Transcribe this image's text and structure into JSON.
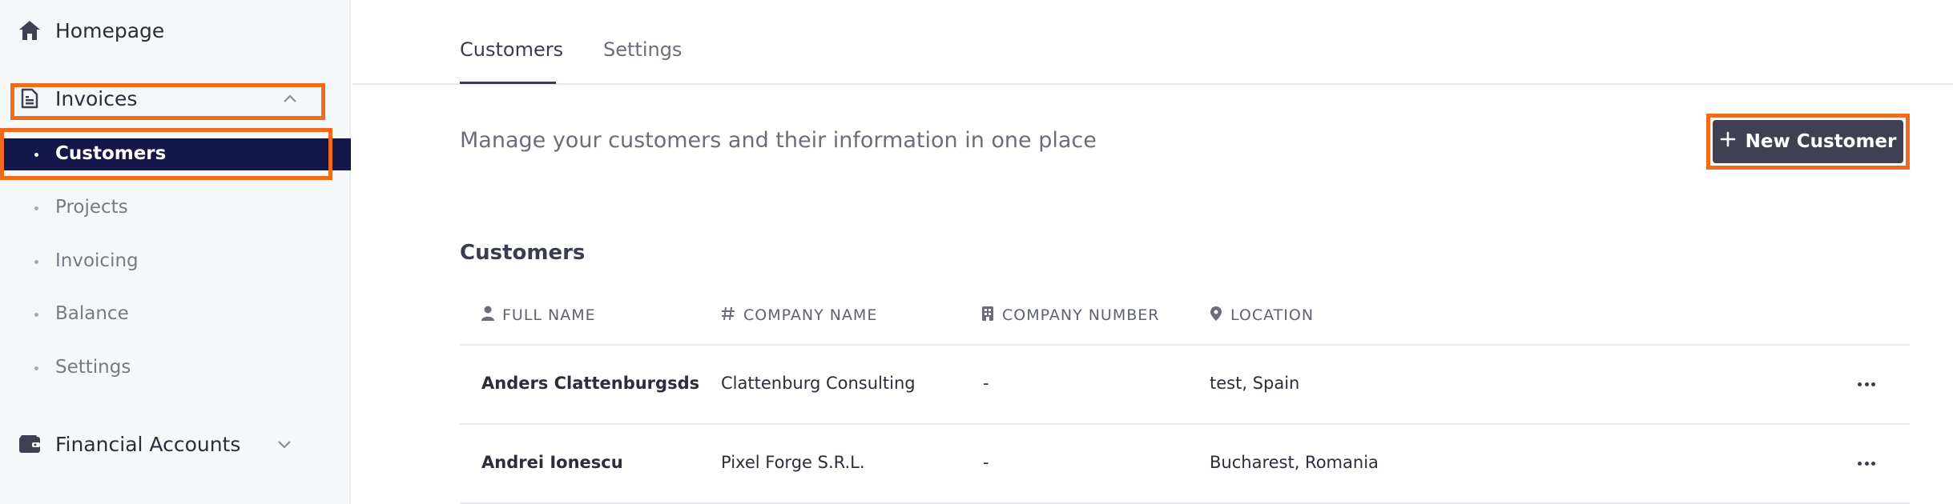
{
  "sidebar": {
    "homepage": {
      "label": "Homepage",
      "icon": "home-icon"
    },
    "invoices": {
      "label": "Invoices",
      "icon": "document-icon",
      "expanded": true
    },
    "sub_items": [
      {
        "label": "Customers",
        "active": true
      },
      {
        "label": "Projects",
        "active": false
      },
      {
        "label": "Invoicing",
        "active": false
      },
      {
        "label": "Balance",
        "active": false
      },
      {
        "label": "Settings",
        "active": false
      }
    ],
    "financial_accounts": {
      "label": "Financial Accounts",
      "icon": "wallet-icon",
      "expanded": false
    }
  },
  "tabs": [
    {
      "label": "Customers",
      "active": true
    },
    {
      "label": "Settings",
      "active": false
    }
  ],
  "header": {
    "subtitle": "Manage your customers and their information in one place",
    "new_button_label": "New Customer"
  },
  "section_title": "Customers",
  "table": {
    "columns": [
      {
        "label": "FULL NAME",
        "icon": "person-icon"
      },
      {
        "label": "COMPANY NAME",
        "icon": "hash-icon"
      },
      {
        "label": "COMPANY NUMBER",
        "icon": "building-icon"
      },
      {
        "label": "LOCATION",
        "icon": "location-pin-icon"
      }
    ],
    "rows": [
      {
        "full_name": "Anders Clattenburgsds",
        "company_name": "Clattenburg Consulting",
        "company_number": "-",
        "location": "test, Spain"
      },
      {
        "full_name": "Andrei Ionescu",
        "company_name": "Pixel Forge S.R.L.",
        "company_number": "-",
        "location": "Bucharest, Romania"
      }
    ]
  },
  "colors": {
    "accent_highlight": "#f26a1b",
    "active_nav_bg": "#151649",
    "button_bg": "#3f4152"
  }
}
